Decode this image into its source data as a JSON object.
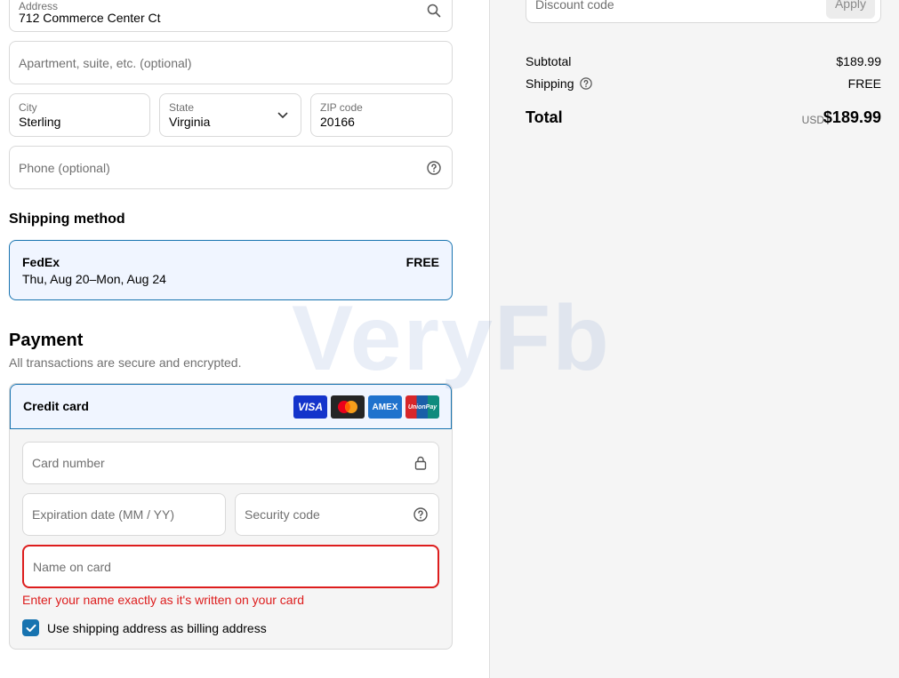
{
  "address": {
    "label": "Address",
    "value": "712 Commerce Center Ct",
    "icon": "search-icon"
  },
  "apartment": {
    "placeholder": "Apartment, suite, etc. (optional)"
  },
  "city": {
    "label": "City",
    "value": "Sterling"
  },
  "state": {
    "label": "State",
    "value": "Virginia"
  },
  "zip": {
    "label": "ZIP code",
    "value": "20166"
  },
  "phone": {
    "placeholder": "Phone (optional)",
    "icon": "help-icon"
  },
  "shipping_method": {
    "title": "Shipping method",
    "option": {
      "name": "FedEx",
      "dates": "Thu, Aug 20–Mon, Aug 24",
      "price": "FREE"
    }
  },
  "payment": {
    "title": "Payment",
    "subtitle": "All transactions are secure and encrypted.",
    "method_label": "Credit card",
    "cards": [
      "VISA",
      "Mastercard",
      "AMEX",
      "UnionPay"
    ],
    "card_number_placeholder": "Card number",
    "expiration_placeholder": "Expiration date (MM / YY)",
    "security_placeholder": "Security code",
    "name_placeholder": "Name on card",
    "name_error": "Enter your name exactly as it's written on your card",
    "billing_checkbox_label": "Use shipping address as billing address",
    "billing_checked": true
  },
  "summary": {
    "discount_placeholder": "Discount code",
    "apply_label": "Apply",
    "subtotal_label": "Subtotal",
    "subtotal_value": "$189.99",
    "shipping_label": "Shipping",
    "shipping_value": "FREE",
    "total_label": "Total",
    "total_currency": "USD",
    "total_value": "$189.99"
  },
  "watermark": "VeryFb",
  "colors": {
    "accent": "#1773b0",
    "error": "#dd1d1d",
    "selected_bg": "#f0f5ff"
  }
}
